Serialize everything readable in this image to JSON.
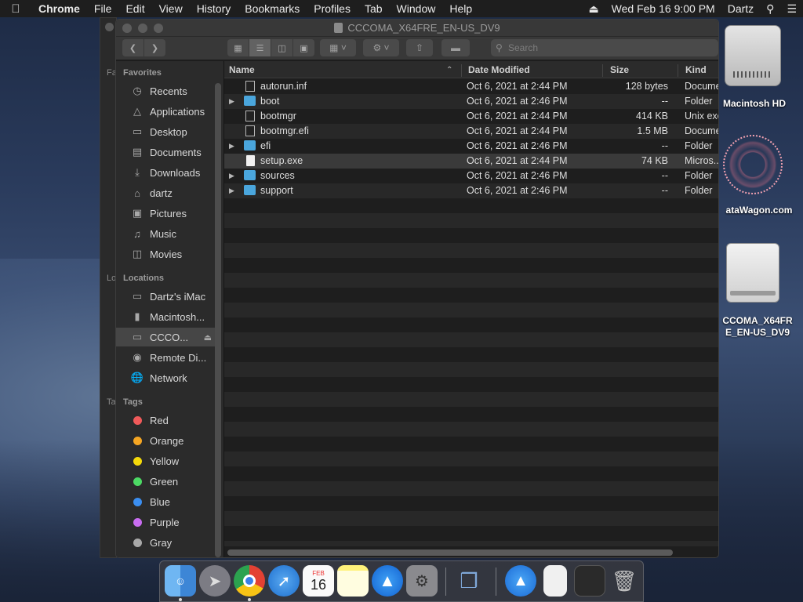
{
  "menubar": {
    "app": "Chrome",
    "items": [
      "File",
      "Edit",
      "View",
      "History",
      "Bookmarks",
      "Profiles",
      "Tab",
      "Window",
      "Help"
    ],
    "clock": "Wed Feb 16  9:00 PM",
    "user": "Dartz"
  },
  "window": {
    "title": "CCCOMA_X64FRE_EN-US_DV9",
    "search_placeholder": "Search"
  },
  "sidebar": {
    "favorites_header": "Favorites",
    "favorites": [
      {
        "label": "Recents",
        "icon": "clock-icon"
      },
      {
        "label": "Applications",
        "icon": "applications-icon"
      },
      {
        "label": "Desktop",
        "icon": "desktop-icon"
      },
      {
        "label": "Documents",
        "icon": "documents-icon"
      },
      {
        "label": "Downloads",
        "icon": "downloads-icon"
      },
      {
        "label": "dartz",
        "icon": "home-icon"
      },
      {
        "label": "Pictures",
        "icon": "camera-icon"
      },
      {
        "label": "Music",
        "icon": "music-icon"
      },
      {
        "label": "Movies",
        "icon": "film-icon"
      }
    ],
    "locations_header": "Locations",
    "locations": [
      {
        "label": "Dartz's iMac",
        "icon": "imac-icon"
      },
      {
        "label": "Macintosh...",
        "icon": "hard-drive-icon"
      },
      {
        "label": "CCCO...",
        "icon": "disk-icon",
        "selected": true
      },
      {
        "label": "Remote Di...",
        "icon": "remote-disc-icon"
      },
      {
        "label": "Network",
        "icon": "network-icon"
      }
    ],
    "tags_header": "Tags",
    "tags": [
      {
        "label": "Red",
        "color": "#f05a5a"
      },
      {
        "label": "Orange",
        "color": "#f5a623"
      },
      {
        "label": "Yellow",
        "color": "#f5d90a"
      },
      {
        "label": "Green",
        "color": "#4cd964"
      },
      {
        "label": "Blue",
        "color": "#3b8ef0"
      },
      {
        "label": "Purple",
        "color": "#c86cf0"
      },
      {
        "label": "Gray",
        "color": "#a8a8a8"
      }
    ]
  },
  "back_window": {
    "labels": [
      "Fa",
      "Lo",
      "Ta"
    ]
  },
  "columns": {
    "name": "Name",
    "date": "Date Modified",
    "size": "Size",
    "kind": "Kind"
  },
  "files": [
    {
      "name": "autorun.inf",
      "date": "Oct 6, 2021 at 2:44 PM",
      "size": "128 bytes",
      "kind": "Docume",
      "type": "doc"
    },
    {
      "name": "boot",
      "date": "Oct 6, 2021 at 2:46 PM",
      "size": "--",
      "kind": "Folder",
      "type": "folder"
    },
    {
      "name": "bootmgr",
      "date": "Oct 6, 2021 at 2:44 PM",
      "size": "414 KB",
      "kind": "Unix exe",
      "type": "doc"
    },
    {
      "name": "bootmgr.efi",
      "date": "Oct 6, 2021 at 2:44 PM",
      "size": "1.5 MB",
      "kind": "Docume",
      "type": "doc"
    },
    {
      "name": "efi",
      "date": "Oct 6, 2021 at 2:46 PM",
      "size": "--",
      "kind": "Folder",
      "type": "folder"
    },
    {
      "name": "setup.exe",
      "date": "Oct 6, 2021 at 2:44 PM",
      "size": "74 KB",
      "kind": "Micros...",
      "type": "white",
      "selected": true
    },
    {
      "name": "sources",
      "date": "Oct 6, 2021 at 2:46 PM",
      "size": "--",
      "kind": "Folder",
      "type": "folder"
    },
    {
      "name": "support",
      "date": "Oct 6, 2021 at 2:46 PM",
      "size": "--",
      "kind": "Folder",
      "type": "folder"
    }
  ],
  "desktop": {
    "icons": [
      {
        "label": "Macintosh HD"
      },
      {
        "label": "ataWagon.com"
      },
      {
        "label": "CCOMA_X64FR\nE_EN-US_DV9"
      }
    ]
  },
  "dock": {
    "calendar_month": "FEB",
    "calendar_day": "16"
  }
}
